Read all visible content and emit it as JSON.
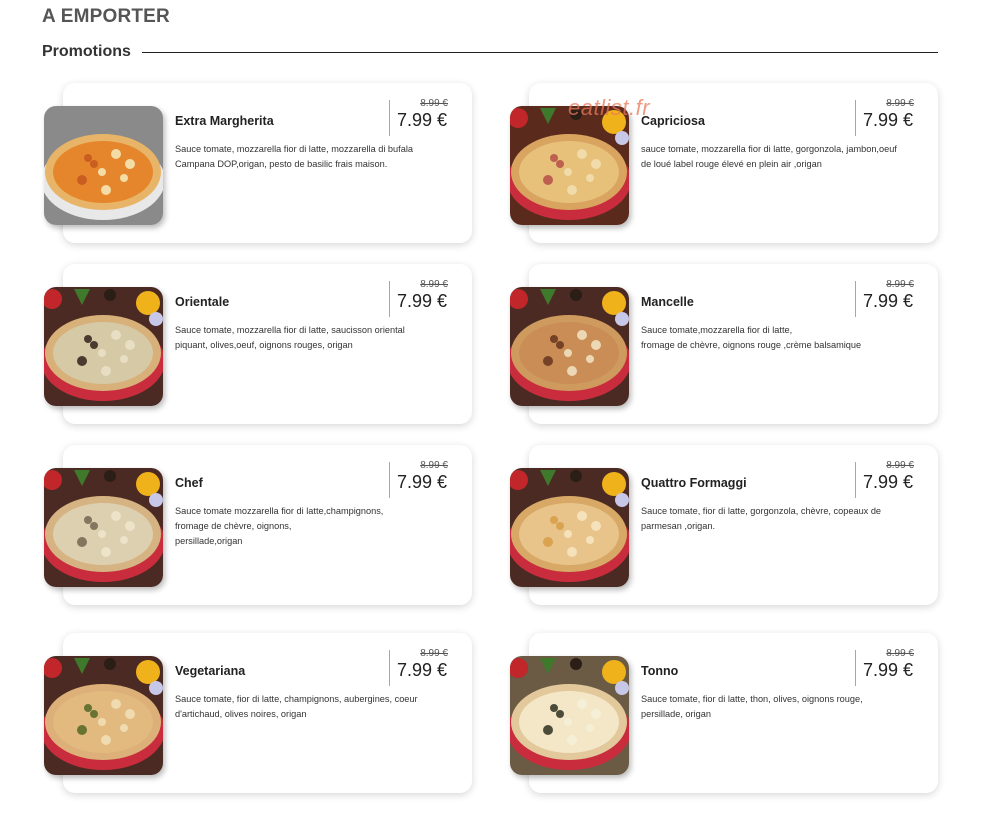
{
  "page": {
    "heading": "A EMPORTER",
    "section_title": "Promotions",
    "watermark": "eatlist.fr"
  },
  "items": [
    {
      "name": "Extra Margherita",
      "description": "Sauce tomate, mozzarella fior di latte, mozzarella di bufala Campana DOP,origan, pesto de basilic frais maison.",
      "old_price": "8.99 €",
      "price": "7.99 €",
      "image": "extra-margherita-pizza"
    },
    {
      "name": "Capriciosa",
      "description": "sauce tomate, mozzarella fior di latte, gorgonzola, jambon,oeuf de loué label rouge élevé en plein air ,origan",
      "old_price": "8.99 €",
      "price": "7.99 €",
      "image": "capriciosa-pizza"
    },
    {
      "name": "Orientale",
      "description": "Sauce tomate, mozzarella fior di latte, saucisson oriental piquant, olives,oeuf, oignons rouges, origan",
      "old_price": "8.99 €",
      "price": "7.99 €",
      "image": "orientale-pizza"
    },
    {
      "name": "Mancelle",
      "description": "Sauce tomate,mozzarella fior di latte,\nfromage de chèvre, oignons rouge ,crème balsamique",
      "old_price": "8.99 €",
      "price": "7.99 €",
      "image": "mancelle-pizza"
    },
    {
      "name": "Chef",
      "description": "Sauce tomate mozzarella fior di latte,champignons,\nfromage de chèvre, oignons,\npersillade,origan",
      "old_price": "8.99 €",
      "price": "7.99 €",
      "image": "chef-pizza"
    },
    {
      "name": "Quattro Formaggi",
      "description": "Sauce tomate, fior di latte, gorgonzola, chèvre, copeaux de parmesan ,origan.",
      "old_price": "8.99 €",
      "price": "7.99 €",
      "image": "quattro-formaggi-pizza"
    },
    {
      "name": "Vegetariana",
      "description": "Sauce tomate, fior di latte, champignons, aubergines, coeur d'artichaud, olives noires, origan",
      "old_price": "8.99 €",
      "price": "7.99 €",
      "image": "vegetariana-pizza"
    },
    {
      "name": "Tonno",
      "description": "Sauce tomate, fior di latte, thon, olives, oignons rouge, persillade, origan",
      "old_price": "8.99 €",
      "price": "7.99 €",
      "image": "tonno-pizza"
    }
  ],
  "colors": {
    "accent_divider": "#d4a62a",
    "heading": "#555555",
    "watermark": "#e8785a"
  }
}
